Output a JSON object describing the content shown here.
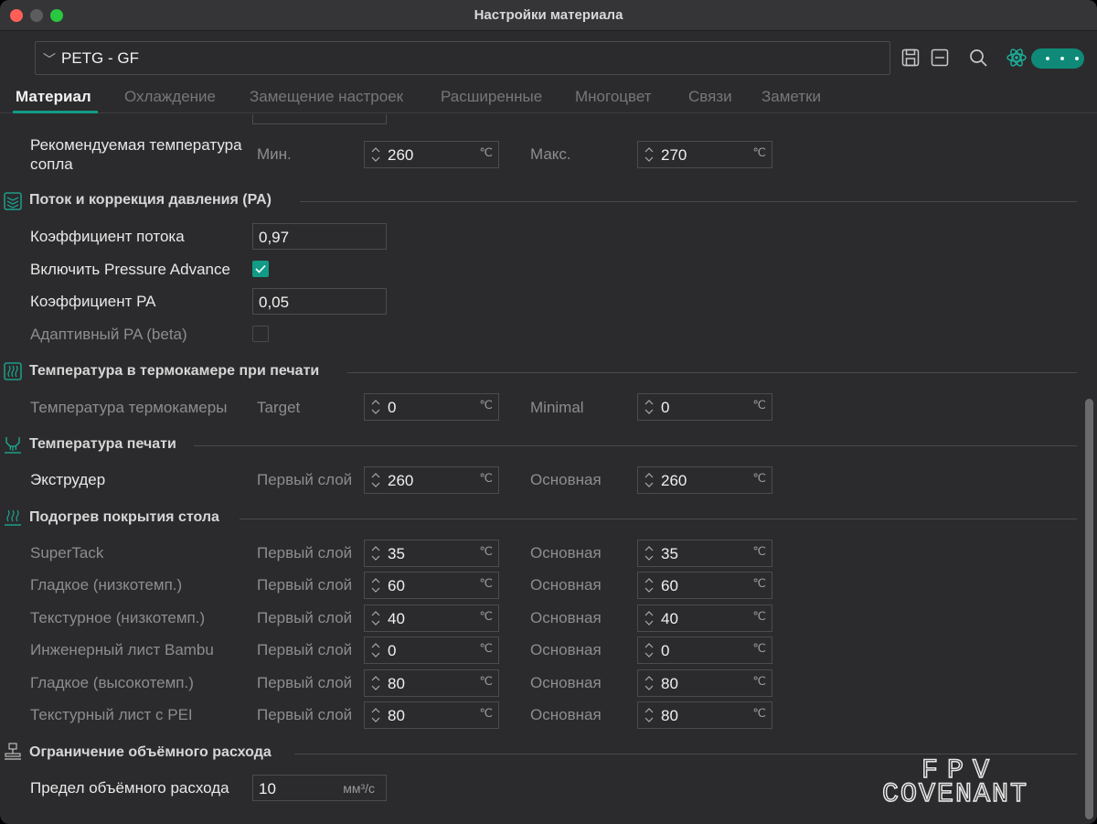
{
  "window": {
    "title": "Настройки материала"
  },
  "preset": {
    "value": "PETG - GF"
  },
  "tabs": [
    "Материал",
    "Охлаждение",
    "Замещение настроек",
    "Расширенные",
    "Многоцвет",
    "Связи",
    "Заметки"
  ],
  "accent": "#129b86",
  "nozzle_temp": {
    "label_line1": "Рекомендуемая температура",
    "label_line2": "сопла",
    "min_label": "Мин.",
    "min_value": "260",
    "max_label": "Макс.",
    "max_value": "270",
    "unit": "℃"
  },
  "flow_section": {
    "title": "Поток и коррекция давления (PA)",
    "flow_ratio_label": "Коэффициент потока",
    "flow_ratio_value": "0,97",
    "enable_pa_label": "Включить Pressure Advance",
    "enable_pa_checked": true,
    "pa_label": "Коэффициент PA",
    "pa_value": "0,05",
    "adaptive_pa_label": "Адаптивный PA (beta)",
    "adaptive_pa_checked": false
  },
  "chamber_section": {
    "title": "Температура в термокамере при печати",
    "label": "Температура термокамеры",
    "target_label": "Target",
    "target_value": "0",
    "minimal_label": "Minimal",
    "minimal_value": "0"
  },
  "print_temp_section": {
    "title": "Температура печати",
    "label": "Экструдер",
    "first_label": "Первый слой",
    "first_value": "260",
    "other_label": "Основная",
    "other_value": "260"
  },
  "bed_section": {
    "title": "Подогрев покрытия стола",
    "first_label": "Первый слой",
    "other_label": "Основная",
    "rows": [
      {
        "label": "SuperTack",
        "first": "35",
        "other": "35"
      },
      {
        "label": "Гладкое (низкотемп.)",
        "first": "60",
        "other": "60"
      },
      {
        "label": "Текстурное (низкотемп.)",
        "first": "40",
        "other": "40"
      },
      {
        "label": "Инженерный лист Bambu",
        "first": "0",
        "other": "0"
      },
      {
        "label": "Гладкое (высокотемп.)",
        "first": "80",
        "other": "80"
      },
      {
        "label": "Текстурный лист с PEI",
        "first": "80",
        "other": "80"
      }
    ]
  },
  "volumetric_section": {
    "title": "Ограничение объёмного расхода",
    "label": "Предел объёмного расхода",
    "value": "10",
    "unit": "мм³/с"
  },
  "watermark": {
    "line1": "FPV",
    "line2": "COVENANT"
  },
  "icons": [
    "save-icon",
    "minus-box-icon",
    "search-icon",
    "atom-icon",
    "flow-icon",
    "chamber-icon",
    "print-temp-icon",
    "bed-heat-icon",
    "volumetric-icon"
  ]
}
